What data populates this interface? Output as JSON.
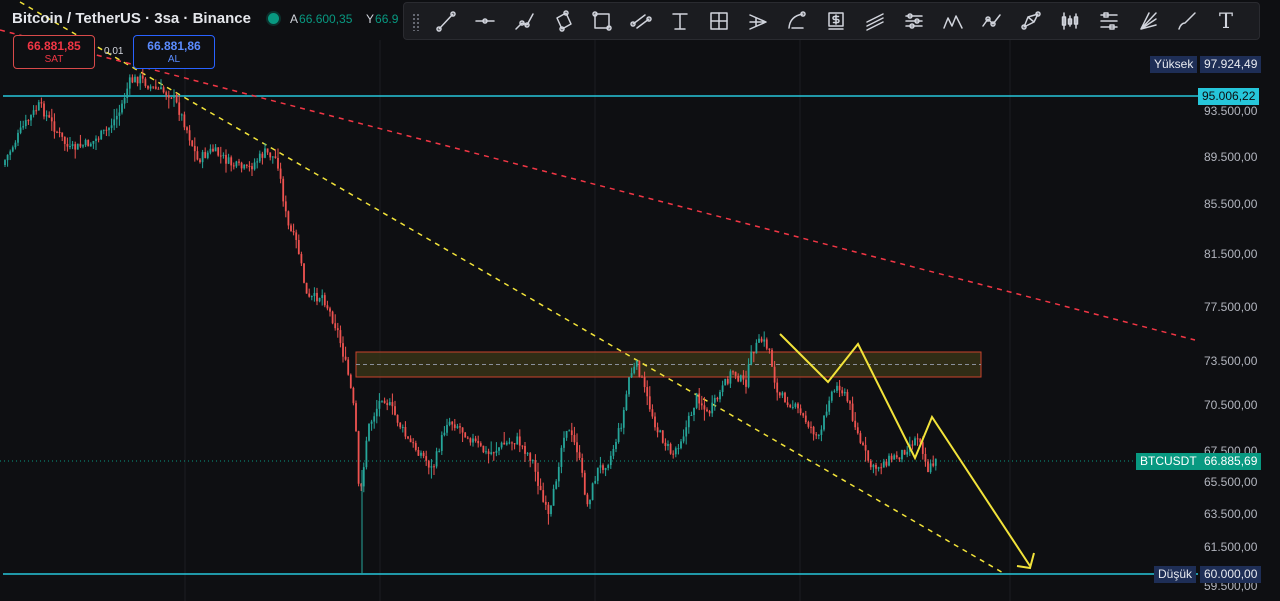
{
  "header": {
    "symbol": "Bitcoin / TetherUS · 3sa · Binance",
    "open_key": "A",
    "open_value": "66.600,35",
    "high_key": "Y",
    "high_value": "66.9"
  },
  "trade": {
    "sell_price": "66.881,85",
    "sell_label": "SAT",
    "spread": "0,01",
    "buy_price": "66.881,86",
    "buy_label": "AL"
  },
  "toolbar": {
    "icons": [
      "trend-line-icon",
      "horizontal-ray-icon",
      "path-icon",
      "rotated-rectangle-icon",
      "rectangle-icon",
      "parallel-channel-icon",
      "fib-retracement-icon",
      "crosshair-box-icon",
      "pitchfork-icon",
      "arc-icon",
      "price-label-icon",
      "regression-icon",
      "elliott-wave-icon",
      "triangle-pattern-icon",
      "polyline-icon",
      "xabcd-pattern-icon",
      "bars-pattern-icon",
      "long-position-icon",
      "gann-fan-icon",
      "brush-icon",
      "text-tool-icon"
    ]
  },
  "axis": {
    "ticks": [
      "93.500,00",
      "89.500,00",
      "85.500,00",
      "81.500,00",
      "77.500,00",
      "73.500,00",
      "70.500,00",
      "67.500,00",
      "65.500,00",
      "63.500,00",
      "61.500,00",
      "59.500,00"
    ],
    "high_label": "Yüksek",
    "high_value": "97.924,49",
    "line_value": "95.006,22",
    "symbol_label": "BTCUSDT",
    "last_value": "66.885,69",
    "low_label": "Düşük",
    "low_value": "60.000,00"
  },
  "colors": {
    "background": "#0e0f12",
    "candle_up": "#26a69a",
    "candle_down": "#ef5350",
    "level_line": "#26c6da",
    "trend_yellow": "#f2e33a",
    "trend_red": "#f23645",
    "zone_border": "#c9432c",
    "zone_fill": "#3a3418"
  }
}
